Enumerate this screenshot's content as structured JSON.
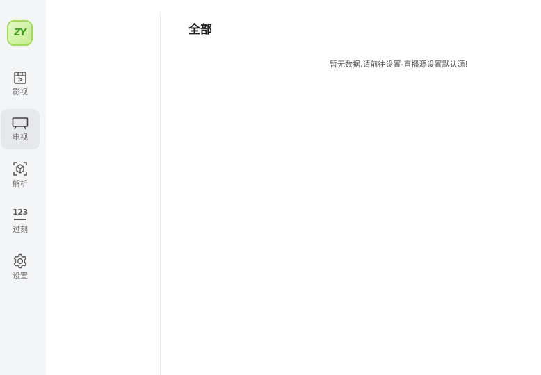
{
  "logo": {
    "text": "ZY",
    "color": "#3f9e1f"
  },
  "nav": {
    "items": [
      {
        "label": "影视",
        "icon": "film-icon",
        "active": false
      },
      {
        "label": "电视",
        "icon": "tv-icon",
        "active": true
      },
      {
        "label": "解析",
        "icon": "parse-icon",
        "active": false
      },
      {
        "label": "过刻",
        "icon": "number-icon",
        "icon_text": "123",
        "active": false
      },
      {
        "label": "设置",
        "icon": "gear-icon",
        "active": false
      }
    ]
  },
  "main": {
    "title": "全部",
    "empty_message": "暂无数据,请前往设置-直播源设置默认源!"
  },
  "colors": {
    "rail_bg": "#f4f5f7",
    "active_bg": "#e7e8eb",
    "logo_border": "#9fdc57"
  }
}
